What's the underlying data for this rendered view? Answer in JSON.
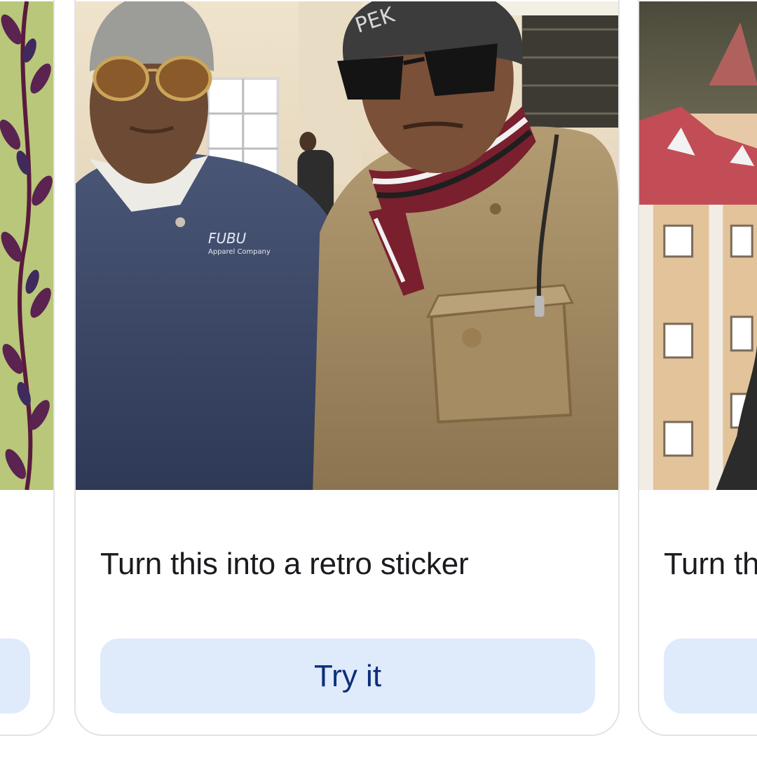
{
  "carousel": {
    "cards": [
      {
        "caption": "",
        "button_label": ""
      },
      {
        "caption": "Turn this into a retro sticker",
        "button_label": "Try it"
      },
      {
        "caption": "Turn th",
        "button_label": ""
      }
    ]
  },
  "photo_text": {
    "jacket_brand": "FUBU",
    "jacket_sub": "Apparel Company"
  },
  "colors": {
    "button_bg": "#dfeafb",
    "button_text": "#0b2f7a",
    "card_border": "#e3e3e6",
    "caption_text": "#1b1b1f"
  }
}
